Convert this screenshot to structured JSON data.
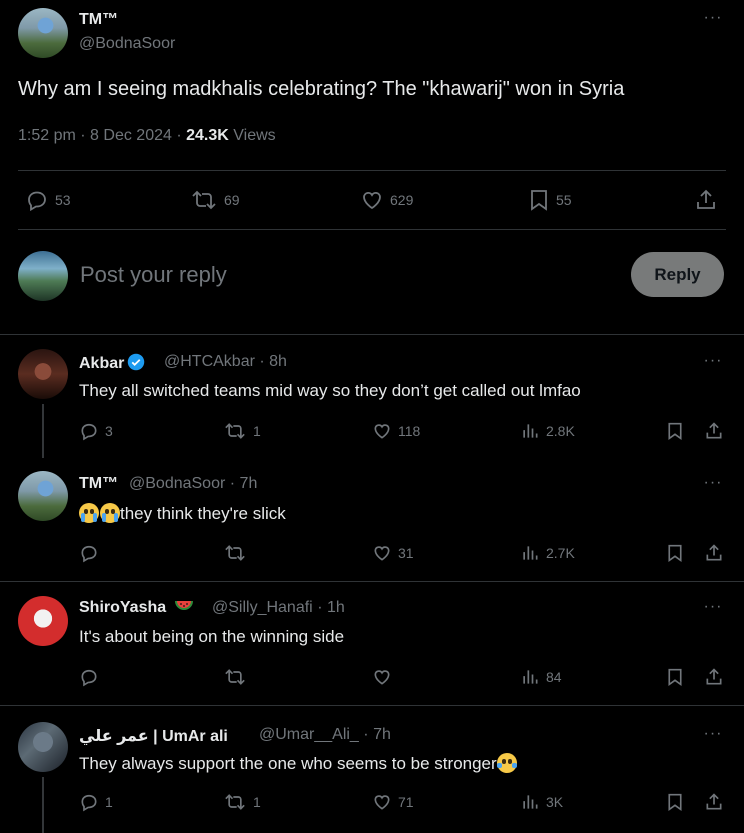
{
  "post": {
    "author_name": "TM™",
    "author_handle": "@BodnaSoor",
    "text": "Why am I seeing madkhalis celebrating? The \"khawarij\" won in Syria",
    "time": "1:52 pm",
    "date": "8 Dec 2024",
    "views_count": "24.3K",
    "views_label": "Views",
    "replies": "53",
    "reposts": "69",
    "likes": "629",
    "bookmarks": "55"
  },
  "composer": {
    "placeholder": "Post your reply",
    "button_label": "Reply"
  },
  "comments": [
    {
      "name": "Akbar",
      "handle": "@HTCAkbar",
      "time": "8h",
      "text": "They all switched teams mid way so they don’t get called out lmfao",
      "replies": "3",
      "reposts": "1",
      "likes": "118",
      "views": "2.8K"
    },
    {
      "name": "TM™",
      "handle": "@BodnaSoor",
      "time": "7h",
      "text": "they think they're slick",
      "replies": "",
      "reposts": "",
      "likes": "31",
      "views": "2.7K"
    },
    {
      "name": "ShiroYasha",
      "handle": "@Silly_Hanafi",
      "time": "1h",
      "text": "It's about being on the winning side",
      "replies": "",
      "reposts": "",
      "likes": "",
      "views": "84"
    },
    {
      "name": "عمر علي | UmAr ali",
      "handle": "@Umar__Ali_",
      "time": "7h",
      "text": "They always support the one who seems to be stronger",
      "replies": "1",
      "reposts": "1",
      "likes": "71",
      "views": "3K"
    }
  ],
  "separator": "·",
  "colors": {
    "background": "#000000",
    "text": "#e7e9ea",
    "muted": "#71767b",
    "divider": "#2f3336",
    "verified": "#1d9bf0",
    "reply_button": "#787a7a"
  }
}
